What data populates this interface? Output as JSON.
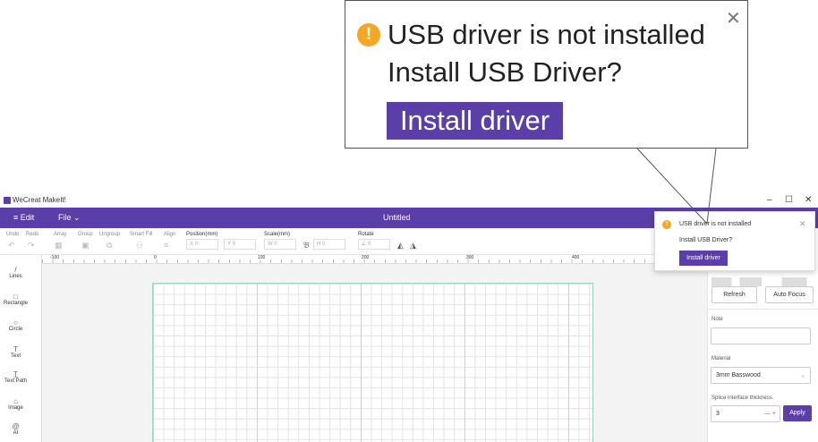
{
  "window": {
    "app_name": "WeCreat MakeIt!",
    "doc_title": "Untitled",
    "minimize": "–",
    "maximize": "☐",
    "close": "✕"
  },
  "menu": {
    "edit": "≡  Edit",
    "file": "File ⌄"
  },
  "toolbar": {
    "undo": "Undo",
    "redo": "Redo",
    "array": "Array",
    "group": "Group",
    "ungroup": "Ungroup",
    "smart_fill": "Smart Fill",
    "align": "Align",
    "position": "Position(mm)",
    "scale": "Scale(mm)",
    "rotate": "Rotate",
    "x_label": "X",
    "x_value": "0",
    "y_label": "Y",
    "y_value": "0",
    "w_label": "W",
    "w_value": "0",
    "h_label": "H",
    "h_value": "0",
    "rot_value": "0"
  },
  "ruler": {
    "labels": [
      "-100",
      "0",
      "100",
      "200",
      "300",
      "400"
    ]
  },
  "sidebar": {
    "items": [
      {
        "label": "Lines",
        "icon": "/"
      },
      {
        "label": "Rectangle",
        "icon": "□"
      },
      {
        "label": "Circle",
        "icon": "○"
      },
      {
        "label": "Text",
        "icon": "T"
      },
      {
        "label": "Text Path",
        "icon": "T̲"
      },
      {
        "label": "Image",
        "icon": "⌂"
      },
      {
        "label": "AI",
        "icon": "@"
      }
    ]
  },
  "right_panel": {
    "refresh": "Refresh",
    "auto_focus": "Auto Focus",
    "note_label": "Note",
    "material_label": "Material",
    "material_value": "3mm Basswood",
    "splice_label": "Splice interface thickness.",
    "splice_value": "3",
    "apply": "Apply"
  },
  "notification": {
    "title": "USB driver is not installed",
    "message": "Install USB Driver?",
    "button": "Install driver",
    "close": "✕"
  },
  "callout": {
    "title": "USB driver is not installed",
    "message": "Install USB Driver?",
    "button": "Install driver",
    "close": "✕"
  },
  "colors": {
    "accent": "#5b3fa8",
    "warning": "#f5a623",
    "board_border": "#9ed3c6"
  }
}
